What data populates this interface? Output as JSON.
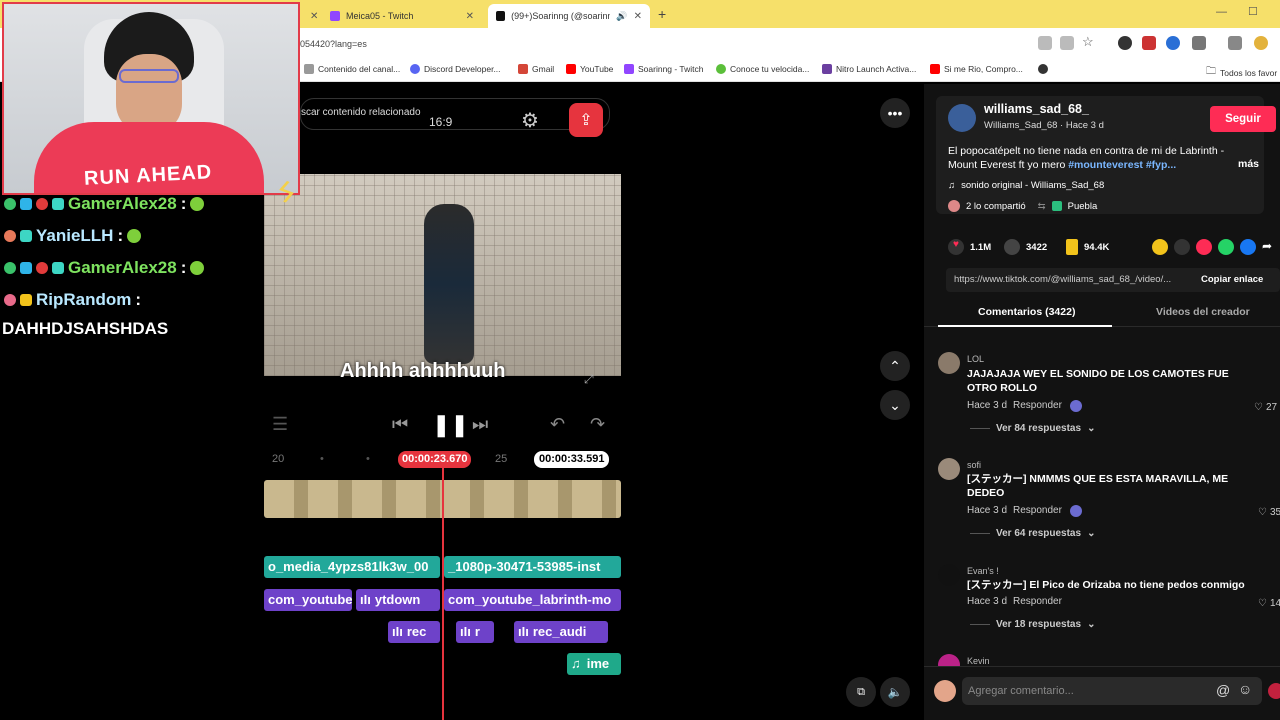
{
  "browser": {
    "tabs": [
      {
        "label": "Meica05 - Twitch"
      },
      {
        "label": "(99+)Soarinng (@soarinng)"
      }
    ],
    "url_fragment": "054420?lang=es",
    "bookmarks": [
      {
        "label": "Contenido del canal..."
      },
      {
        "label": "Discord Developer..."
      },
      {
        "label": "Gmail"
      },
      {
        "label": "YouTube"
      },
      {
        "label": "Soarinng - Twitch"
      },
      {
        "label": "Conoce tu velocida..."
      },
      {
        "label": "Nitro Launch Activa..."
      },
      {
        "label": "Si me Rio, Compro..."
      },
      {
        "label": "Todos los favor"
      }
    ]
  },
  "webcam": {
    "shirt_text": "RUN AHEAD"
  },
  "chat": [
    {
      "user": "GamerAlex28",
      "message": ":",
      "color": "#7ee35f"
    },
    {
      "user": "YanieLLH",
      "message": ":",
      "color": "#b9e8ff"
    },
    {
      "user": "GamerAlex28",
      "message": ":",
      "color": "#7ee35f"
    },
    {
      "user": "RipRandom",
      "message": ":",
      "color": "#b9e8ff"
    },
    {
      "user": "",
      "message": "DAHHDJSAHSHDAS",
      "color": "#ffffff"
    }
  ],
  "editor": {
    "search_partial": "scar contenido relacionado",
    "aspect": "16:9",
    "subtitle": "Ahhhh ahhhhuuh",
    "ruler_left": "20",
    "ruler_right": "25",
    "current_time": "00:00:23.670",
    "total_time": "00:00:33.591",
    "clips": {
      "video_1": "o_media_4ypzs81lk3w_00",
      "video_2": "_1080p-30471-53985-inst",
      "audio_1": "com_youtube_",
      "audio_2": "ytdown",
      "audio_3": "com_youtube_labrinth-mo",
      "rec_1": "rec",
      "rec_2": "r",
      "rec_3": "rec_audi",
      "music": "ime"
    }
  },
  "tiktok": {
    "author": "williams_sad_68_",
    "author_sub": "Williams_Sad_68 · Hace 3 d",
    "follow_label": "Seguir",
    "caption": "El popocatépelt no tiene nada en contra de mi de Labrinth - Mount Everest ft yo mero",
    "hashtags": "#mounteverest #fyp...",
    "more_label": "más",
    "sound": "sonido original - Williams_Sad_68",
    "shared": "2 lo compartió",
    "location": "Puebla",
    "likes": "1.1M",
    "comments_count": "3422",
    "saves": "94.4K",
    "link": "https://www.tiktok.com/@williams_sad_68_/video/...",
    "copy_link": "Copiar enlace",
    "tab_comments": "Comentarios (3422)",
    "tab_videos": "Videos del creador",
    "comments": [
      {
        "name": "LOL",
        "text": "JAJAJAJA WEY EL SONIDO DE LOS CAMOTES FUE OTRO ROLLO",
        "time": "Hace 3 d",
        "reply": "Responder",
        "likes": "27",
        "replies": "Ver 84 respuestas"
      },
      {
        "name": "sofi",
        "text": "[ステッカー] NMMMS QUE ES ESTA MARAVILLA, ME DEDEO",
        "time": "Hace 3 d",
        "reply": "Responder",
        "likes": "35",
        "replies": "Ver 64 respuestas"
      },
      {
        "name": "Evan's !",
        "text": "[ステッカー] El Pico de Orizaba no tiene pedos conmigo",
        "time": "Hace 3 d",
        "reply": "Responder",
        "likes": "14",
        "replies": "Ver 18 respuestas"
      },
      {
        "name": "Kevin"
      }
    ],
    "comment_placeholder": "Agregar comentario..."
  }
}
